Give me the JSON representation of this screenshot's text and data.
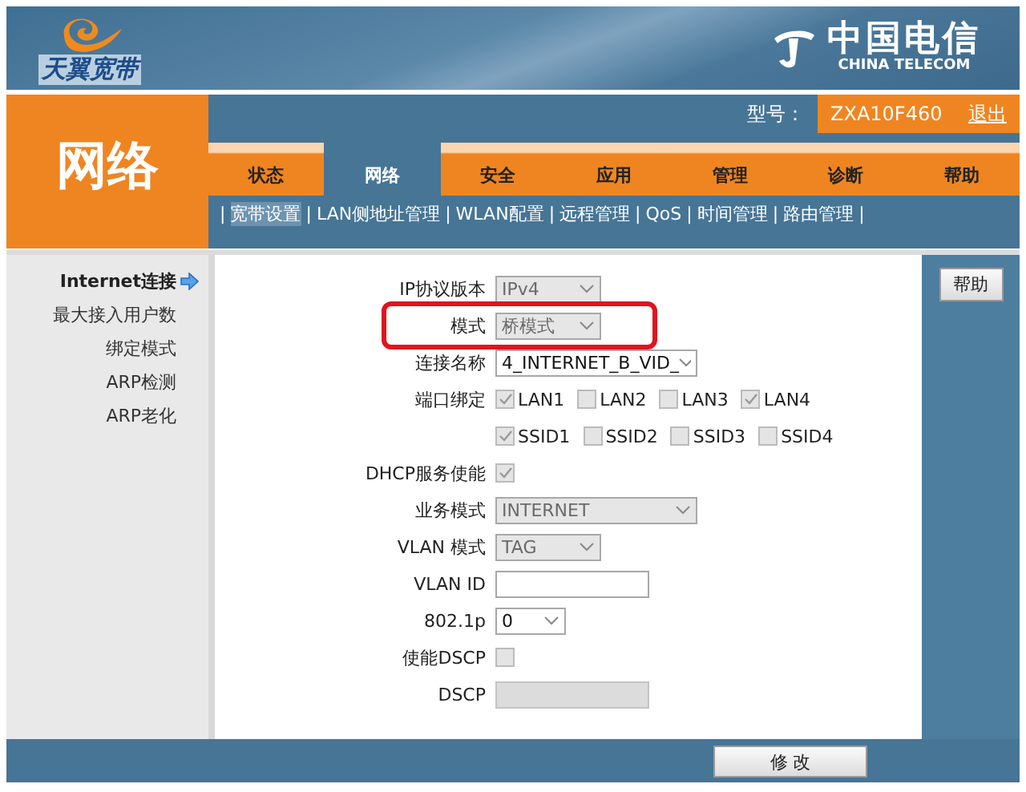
{
  "header": {
    "brand_left": "天翼宽带",
    "brand_right": "中国电信",
    "brand_right_sub": "CHINA TELECOM"
  },
  "section_title": "网络",
  "model": {
    "label": "型号：",
    "value": "ZXA10F460"
  },
  "logout": "退出",
  "tabs": [
    {
      "label": "状态",
      "selected": false
    },
    {
      "label": "网络",
      "selected": true
    },
    {
      "label": "安全",
      "selected": false
    },
    {
      "label": "应用",
      "selected": false
    },
    {
      "label": "管理",
      "selected": false
    },
    {
      "label": "诊断",
      "selected": false
    },
    {
      "label": "帮助",
      "selected": false
    }
  ],
  "subnav": [
    {
      "kind": "separator",
      "label": "|"
    },
    {
      "kind": "link",
      "label": "宽带设置",
      "selected": true
    },
    {
      "kind": "separator",
      "label": "|"
    },
    {
      "kind": "link",
      "label": "LAN侧地址管理",
      "selected": false
    },
    {
      "kind": "separator",
      "label": "|"
    },
    {
      "kind": "link",
      "label": "WLAN配置",
      "selected": false
    },
    {
      "kind": "separator",
      "label": "|"
    },
    {
      "kind": "link",
      "label": "远程管理",
      "selected": false
    },
    {
      "kind": "separator",
      "label": "|"
    },
    {
      "kind": "link",
      "label": "QoS",
      "selected": false
    },
    {
      "kind": "separator",
      "label": "|"
    },
    {
      "kind": "link",
      "label": "时间管理",
      "selected": false
    },
    {
      "kind": "separator",
      "label": "|"
    },
    {
      "kind": "link",
      "label": "路由管理",
      "selected": false
    },
    {
      "kind": "separator",
      "label": "|"
    }
  ],
  "sidebar": [
    {
      "label": "Internet连接",
      "selected": true
    },
    {
      "label": "最大接入用户数",
      "selected": false
    },
    {
      "label": "绑定模式",
      "selected": false
    },
    {
      "label": "ARP检测",
      "selected": false
    },
    {
      "label": "ARP老化",
      "selected": false
    }
  ],
  "form": [
    {
      "kind": "select",
      "label": "IP协议版本",
      "value": "IPv4",
      "disabled": true
    },
    {
      "kind": "select",
      "label": "模式",
      "value": "桥模式",
      "disabled": true,
      "highlighted": true
    },
    {
      "kind": "select",
      "label": "连接名称",
      "value": "4_INTERNET_B_VID_",
      "disabled": false
    },
    {
      "kind": "checkboxes",
      "label": "端口绑定",
      "options": [
        {
          "label": "LAN1",
          "checked": true
        },
        {
          "label": "LAN2",
          "checked": false
        },
        {
          "label": "LAN3",
          "checked": false
        },
        {
          "label": "LAN4",
          "checked": true
        }
      ]
    },
    {
      "kind": "checkboxes",
      "options": [
        {
          "label": "SSID1",
          "checked": true
        },
        {
          "label": "SSID2",
          "checked": false
        },
        {
          "label": "SSID3",
          "checked": false
        },
        {
          "label": "SSID4",
          "checked": false
        }
      ]
    },
    {
      "kind": "checkbox",
      "label": "DHCP服务使能",
      "checked": true
    },
    {
      "kind": "select",
      "label": "业务模式",
      "value": "INTERNET",
      "disabled": true
    },
    {
      "kind": "select",
      "label": "VLAN 模式",
      "value": "TAG",
      "disabled": true
    },
    {
      "kind": "text",
      "label": "VLAN ID",
      "disabled": false
    },
    {
      "kind": "select",
      "label": "802.1p",
      "value": "0",
      "disabled": false
    },
    {
      "kind": "checkbox",
      "label": "使能DSCP",
      "checked": false
    },
    {
      "kind": "text",
      "label": "DSCP",
      "disabled": true
    }
  ],
  "help_button": "帮助",
  "submit_button": "修 改"
}
